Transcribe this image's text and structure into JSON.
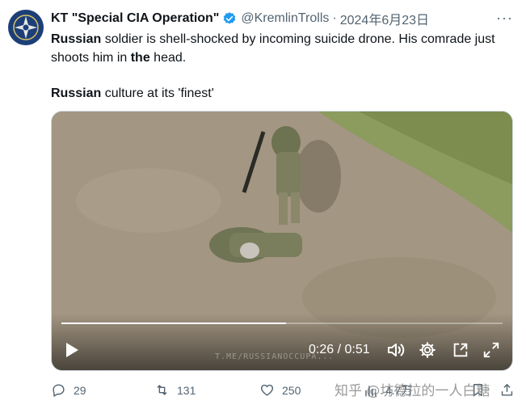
{
  "tweet": {
    "display_name": "KT \"Special CIA Operation\"",
    "handle": "@KremlinTrolls",
    "separator": "·",
    "date": "2024年6月23日",
    "more": "···",
    "line1_bold": "Russian",
    "line1_rest": " soldier is shell-shocked by incoming suicide drone. His comrade just shoots him in ",
    "line1_bold2": "the",
    "line1_end": " head.",
    "line2_bold": "Russian",
    "line2_rest": " culture at its 'finest'"
  },
  "video": {
    "time_label": "0:26 / 0:51",
    "progress": 0.51,
    "watermark": "T.ME/RUSSIANOCCUPA..."
  },
  "actions": {
    "replies": "29",
    "retweets": "131",
    "likes": "250",
    "views": "4.7万"
  },
  "overlay": {
    "zhihu_watermark": "知乎 @坊德拉的一人白糖"
  },
  "colors": {
    "verified": "#1d9bf0",
    "muted": "#536471"
  }
}
